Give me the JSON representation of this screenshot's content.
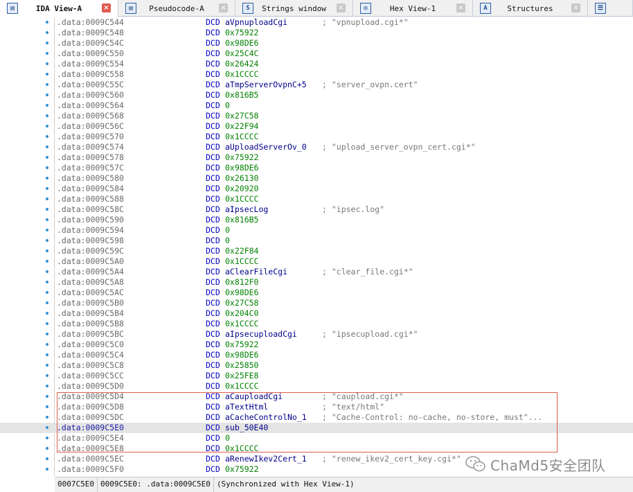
{
  "tabs": [
    {
      "label": "IDA View-A",
      "icon": "ida-view-icon",
      "active": true
    },
    {
      "label": "Pseudocode-A",
      "icon": "pseudocode-icon",
      "active": false
    },
    {
      "label": "Strings window",
      "icon": "strings-icon",
      "active": false
    },
    {
      "label": "Hex View-1",
      "icon": "hex-view-icon",
      "active": false
    },
    {
      "label": "Structures",
      "icon": "structures-icon",
      "active": false
    },
    {
      "label": "",
      "icon": "enums-icon",
      "active": false
    }
  ],
  "listing": [
    {
      "addr": ".data:0009C544",
      "op": "aVpnuploadCgi",
      "comment": "; \"vpnupload.cgi*\""
    },
    {
      "addr": ".data:0009C548",
      "op": "0x75922",
      "comment": ""
    },
    {
      "addr": ".data:0009C54C",
      "op": "0x98DE6",
      "comment": ""
    },
    {
      "addr": ".data:0009C550",
      "op": "0x25C4C",
      "comment": ""
    },
    {
      "addr": ".data:0009C554",
      "op": "0x26424",
      "comment": ""
    },
    {
      "addr": ".data:0009C558",
      "op": "0x1CCCC",
      "comment": ""
    },
    {
      "addr": ".data:0009C55C",
      "op": "aTmpServerOvpnC+5",
      "comment": "; \"server_ovpn.cert\""
    },
    {
      "addr": ".data:0009C560",
      "op": "0x816B5",
      "comment": ""
    },
    {
      "addr": ".data:0009C564",
      "op": "0",
      "comment": ""
    },
    {
      "addr": ".data:0009C568",
      "op": "0x27C58",
      "comment": ""
    },
    {
      "addr": ".data:0009C56C",
      "op": "0x22F94",
      "comment": ""
    },
    {
      "addr": ".data:0009C570",
      "op": "0x1CCCC",
      "comment": ""
    },
    {
      "addr": ".data:0009C574",
      "op": "aUploadServerOv_0",
      "comment": "; \"upload_server_ovpn_cert.cgi*\""
    },
    {
      "addr": ".data:0009C578",
      "op": "0x75922",
      "comment": ""
    },
    {
      "addr": ".data:0009C57C",
      "op": "0x98DE6",
      "comment": ""
    },
    {
      "addr": ".data:0009C580",
      "op": "0x26130",
      "comment": ""
    },
    {
      "addr": ".data:0009C584",
      "op": "0x20920",
      "comment": ""
    },
    {
      "addr": ".data:0009C588",
      "op": "0x1CCCC",
      "comment": ""
    },
    {
      "addr": ".data:0009C58C",
      "op": "aIpsecLog",
      "comment": "; \"ipsec.log\""
    },
    {
      "addr": ".data:0009C590",
      "op": "0x816B5",
      "comment": ""
    },
    {
      "addr": ".data:0009C594",
      "op": "0",
      "comment": ""
    },
    {
      "addr": ".data:0009C598",
      "op": "0",
      "comment": ""
    },
    {
      "addr": ".data:0009C59C",
      "op": "0x22F84",
      "comment": ""
    },
    {
      "addr": ".data:0009C5A0",
      "op": "0x1CCCC",
      "comment": ""
    },
    {
      "addr": ".data:0009C5A4",
      "op": "aClearFileCgi",
      "comment": "; \"clear_file.cgi*\""
    },
    {
      "addr": ".data:0009C5A8",
      "op": "0x812F0",
      "comment": ""
    },
    {
      "addr": ".data:0009C5AC",
      "op": "0x98DE6",
      "comment": ""
    },
    {
      "addr": ".data:0009C5B0",
      "op": "0x27C58",
      "comment": ""
    },
    {
      "addr": ".data:0009C5B4",
      "op": "0x204C0",
      "comment": ""
    },
    {
      "addr": ".data:0009C5B8",
      "op": "0x1CCCC",
      "comment": ""
    },
    {
      "addr": ".data:0009C5BC",
      "op": "aIpsecuploadCgi",
      "comment": "; \"ipsecupload.cgi*\""
    },
    {
      "addr": ".data:0009C5C0",
      "op": "0x75922",
      "comment": ""
    },
    {
      "addr": ".data:0009C5C4",
      "op": "0x98DE6",
      "comment": ""
    },
    {
      "addr": ".data:0009C5C8",
      "op": "0x25850",
      "comment": ""
    },
    {
      "addr": ".data:0009C5CC",
      "op": "0x25FE8",
      "comment": ""
    },
    {
      "addr": ".data:0009C5D0",
      "op": "0x1CCCC",
      "comment": ""
    },
    {
      "addr": ".data:0009C5D4",
      "op": "aCauploadCgi",
      "comment": "; \"caupload.cgi*\""
    },
    {
      "addr": ".data:0009C5D8",
      "op": "aTextHtml",
      "comment": "; \"text/html\""
    },
    {
      "addr": ".data:0009C5DC",
      "op": "aCacheControlNo_1",
      "comment": "; \"Cache-Control: no-cache, no-store, must\"..."
    },
    {
      "addr": ".data:0009C5E0",
      "op": "sub_50E40",
      "comment": "",
      "selected": true
    },
    {
      "addr": ".data:0009C5E4",
      "op": "0",
      "comment": ""
    },
    {
      "addr": ".data:0009C5E8",
      "op": "0x1CCCC",
      "comment": ""
    },
    {
      "addr": ".data:0009C5EC",
      "op": "aRenewIkev2Cert_1",
      "comment": "; \"renew_ikev2_cert_key.cgi*\""
    },
    {
      "addr": ".data:0009C5F0",
      "op": "0x75922",
      "comment": ""
    }
  ],
  "directive": "DCD",
  "status": {
    "offset": "0007C5E0",
    "location": "0009C5E0: .data:0009C5E0",
    "sync": "(Synchronized with Hex View-1)"
  },
  "watermark": {
    "text": "ChaMd5安全团队",
    "icon": "wechat-icon"
  },
  "colors": {
    "highlight_box": "#e05b4d",
    "directive": "#0000c0",
    "number": "#008000",
    "name": "#00008a",
    "active_close": "#e05a4f"
  }
}
